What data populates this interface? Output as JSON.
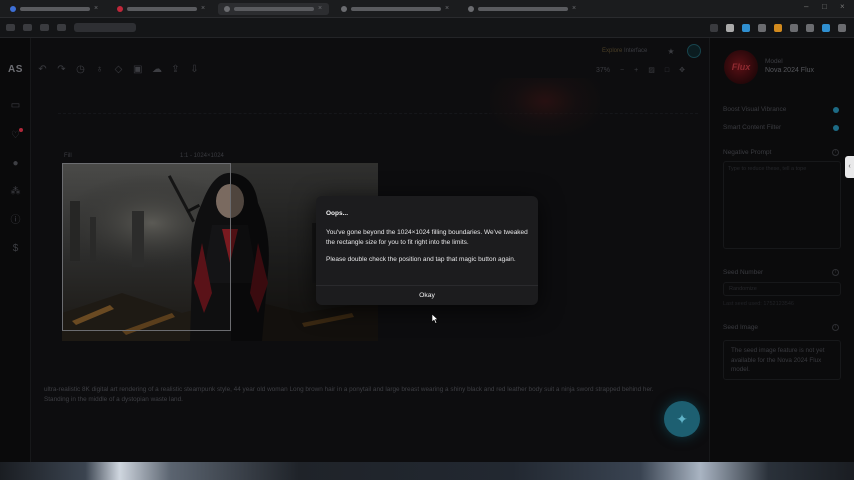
{
  "app": {
    "brand": "AS",
    "header": {
      "explore_label": "Explore",
      "interface_label": "Interface"
    },
    "zoom": "37%"
  },
  "canvas": {
    "fill_label": "Fill",
    "size_label": "1:1 - 1024×1024",
    "prompt": "ultra-realistic 8K digital art rendering of a realistic steampunk style, 44 year old woman Long brown hair in a ponytail and large breast wearing a shiny black and red leather body suit a ninja sword strapped behind her. Standing in the middle of a dystopian waste land."
  },
  "panel": {
    "model_logo_text": "Flux",
    "model_label": "Model",
    "model_name": "Nova 2024 Flux",
    "boost_label": "Boost Visual Vibrance",
    "smart_filter_label": "Smart Content Filter",
    "negative_prompt_label": "Negative Prompt",
    "negative_placeholder": "Type to reduce these, tell a tope",
    "seed_number_label": "Seed Number",
    "seed_placeholder": "Randomize",
    "seed_sub": "Last seed used: 1752123546",
    "seed_image_label": "Seed Image",
    "seed_image_note": "The seed image feature is not yet available for the Nova 2024 Flux model."
  },
  "dialog": {
    "title": "Oops...",
    "message1": "You've gone beyond the 1024×1024 filling boundaries. We've tweaked the rectangle size for you to fit right into the limits.",
    "message2": "Please double check the position and tap that magic button again.",
    "ok_label": "Okay"
  },
  "colors": {
    "accent": "#1d6b85",
    "dialog_bg": "#1c1c1e",
    "app_bg": "#0d0d0f"
  }
}
